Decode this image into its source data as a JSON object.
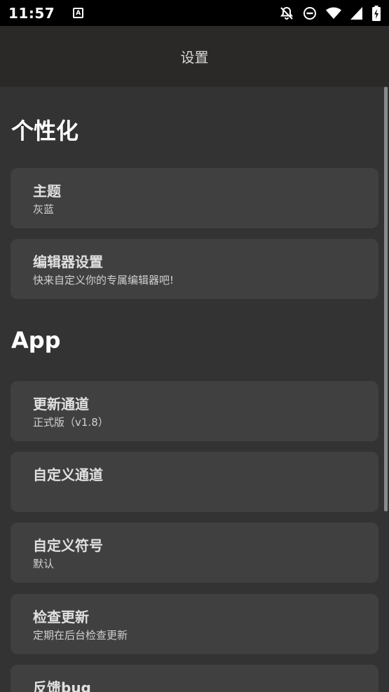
{
  "status_bar": {
    "time": "11:57",
    "notification_icon": "A",
    "icons": [
      "notifications-off-icon",
      "do-not-disturb-icon",
      "wifi-icon",
      "signal-icon",
      "battery-charging-icon"
    ]
  },
  "app_bar": {
    "title": "设置"
  },
  "sections": [
    {
      "title": "个性化",
      "items": [
        {
          "title": "主题",
          "subtitle": "灰蓝"
        },
        {
          "title": "编辑器设置",
          "subtitle": "快来自定义你的专属编辑器吧!"
        }
      ]
    },
    {
      "title": "App",
      "items": [
        {
          "title": "更新通道",
          "subtitle": "正式版（v1.8）"
        },
        {
          "title": "自定义通道",
          "subtitle": ""
        },
        {
          "title": "自定义符号",
          "subtitle": "默认"
        },
        {
          "title": "检查更新",
          "subtitle": "定期在后台检查更新"
        },
        {
          "title": "反馈bug",
          "subtitle": ""
        }
      ]
    }
  ]
}
